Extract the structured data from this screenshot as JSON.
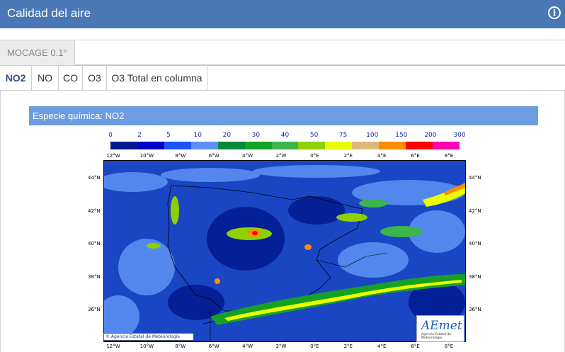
{
  "header": {
    "title": "Calidad del aire",
    "info_icon": "i"
  },
  "model_tabs": [
    {
      "label": "MOCAGE 0.1°",
      "active": true
    }
  ],
  "species_tabs": [
    {
      "label": "NO2",
      "active": true
    },
    {
      "label": "NO",
      "active": false
    },
    {
      "label": "CO",
      "active": false
    },
    {
      "label": "O3",
      "active": false
    },
    {
      "label": "O3 Total en columna",
      "active": false
    }
  ],
  "panel": {
    "species_label": "Especie química: NO2"
  },
  "map": {
    "legend_values": [
      "0",
      "2",
      "5",
      "10",
      "20",
      "30",
      "40",
      "50",
      "75",
      "100",
      "150",
      "200",
      "300"
    ],
    "legend_colors": [
      "#001a8f",
      "#0000cc",
      "#1d53ff",
      "#5b8ff2",
      "#008a3a",
      "#15a125",
      "#3cb54a",
      "#8ed000",
      "#e9ff00",
      "#ddb978",
      "#ff8c00",
      "#ff0000",
      "#ff00b4"
    ],
    "lon_labels": [
      "12°W",
      "10°W",
      "8°W",
      "6°W",
      "4°W",
      "2°W",
      "0°E",
      "2°E",
      "4°E",
      "6°E",
      "8°E"
    ],
    "lat_labels": [
      "44°N",
      "42°N",
      "40°N",
      "38°N",
      "36°N"
    ],
    "credit": "© Agencia Estatal de Meteorología",
    "logo_text": "AEmet",
    "logo_subtitle": "Agencia Estatal de Meteorología"
  }
}
